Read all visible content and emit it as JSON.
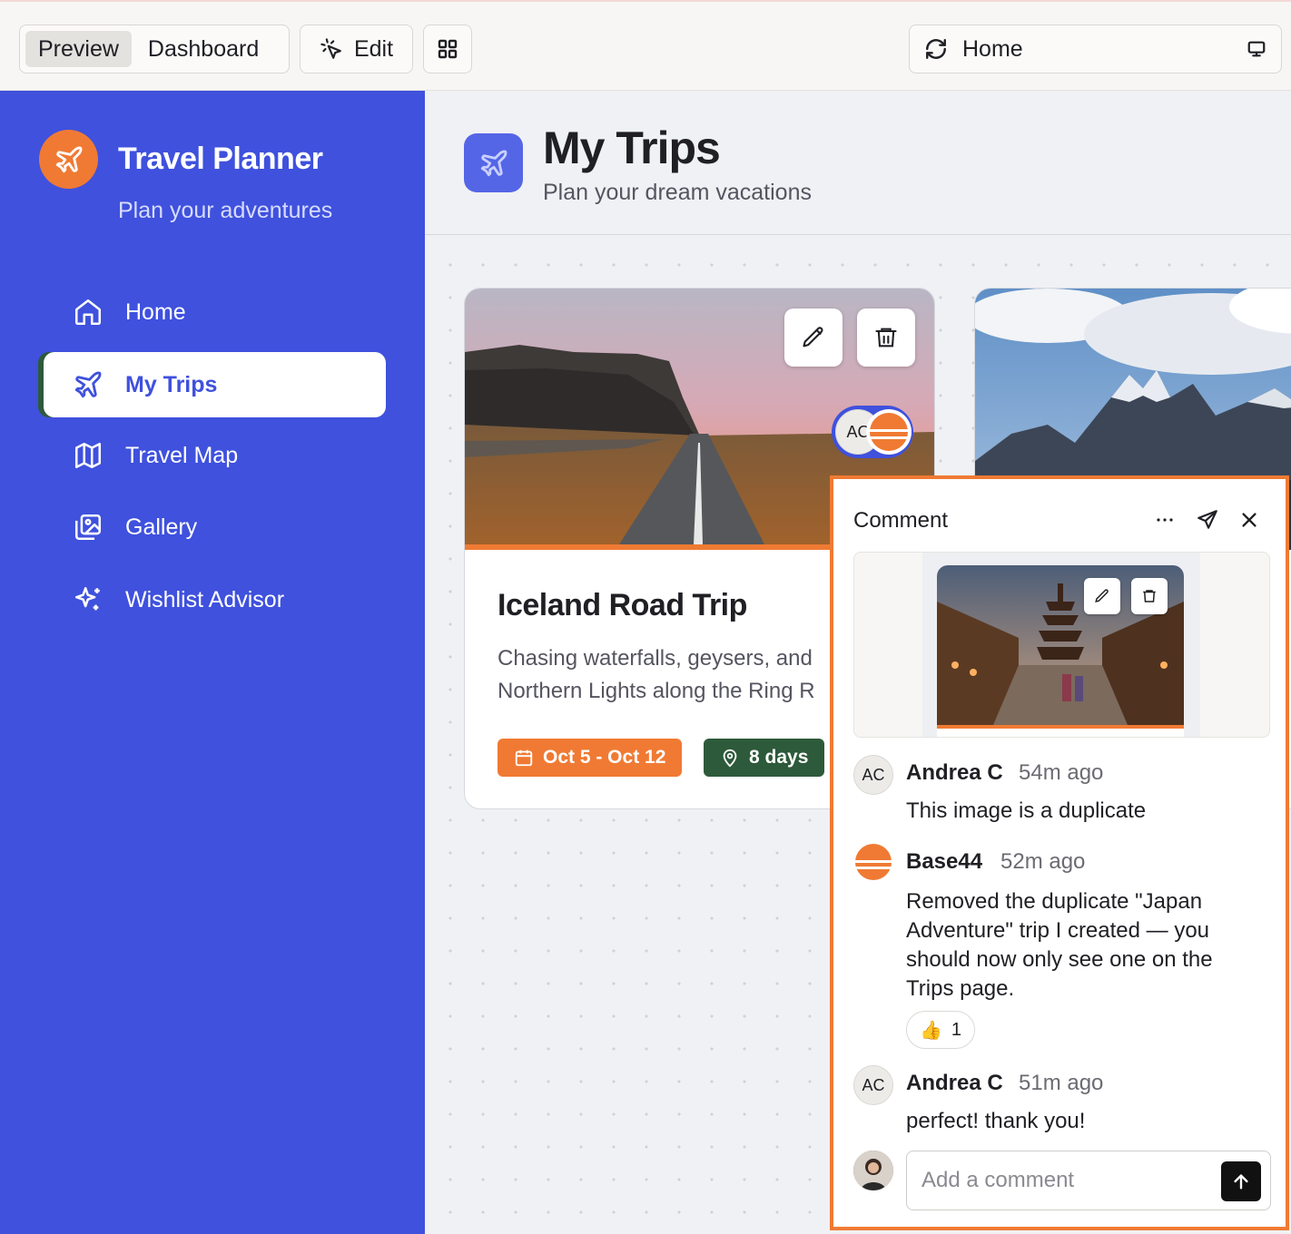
{
  "toolbar": {
    "preview_label": "Preview",
    "dashboard_label": "Dashboard",
    "edit_label": "Edit",
    "url_label": "Home"
  },
  "sidebar": {
    "brand_title": "Travel Planner",
    "brand_subtitle": "Plan your adventures",
    "items": [
      {
        "label": "Home",
        "icon": "home-icon",
        "active": false
      },
      {
        "label": "My Trips",
        "icon": "plane-icon",
        "active": true
      },
      {
        "label": "Travel Map",
        "icon": "map-icon",
        "active": false
      },
      {
        "label": "Gallery",
        "icon": "gallery-icon",
        "active": false
      },
      {
        "label": "Wishlist Advisor",
        "icon": "sparkles-icon",
        "active": false
      }
    ]
  },
  "page": {
    "title": "My Trips",
    "subtitle": "Plan your dream vacations"
  },
  "trip_card": {
    "title": "Iceland Road Trip",
    "description": "Chasing waterfalls, geysers, and Northern Lights along the Ring R",
    "date_badge": "Oct 5 - Oct 12",
    "duration_badge": "8 days"
  },
  "collaborators": {
    "initials": "AC"
  },
  "comment_panel": {
    "title": "Comment",
    "comments": [
      {
        "initials": "AC",
        "author": "Andrea C",
        "time": "54m ago",
        "text": "This image is a duplicate"
      },
      {
        "initials": "",
        "author": "Base44",
        "time": "52m ago",
        "text": "Removed the duplicate \"Japan Adventure\" trip I created — you should now only see one on the Trips page."
      },
      {
        "initials": "AC",
        "author": "Andrea C",
        "time": "51m ago",
        "text": "perfect! thank you!"
      }
    ],
    "reaction": {
      "emoji": "👍",
      "count": "1"
    },
    "input_placeholder": "Add a comment"
  },
  "colors": {
    "sidebar": "#3f51dd",
    "accent": "#f07a33",
    "duration_badge": "#2d5a3a"
  }
}
